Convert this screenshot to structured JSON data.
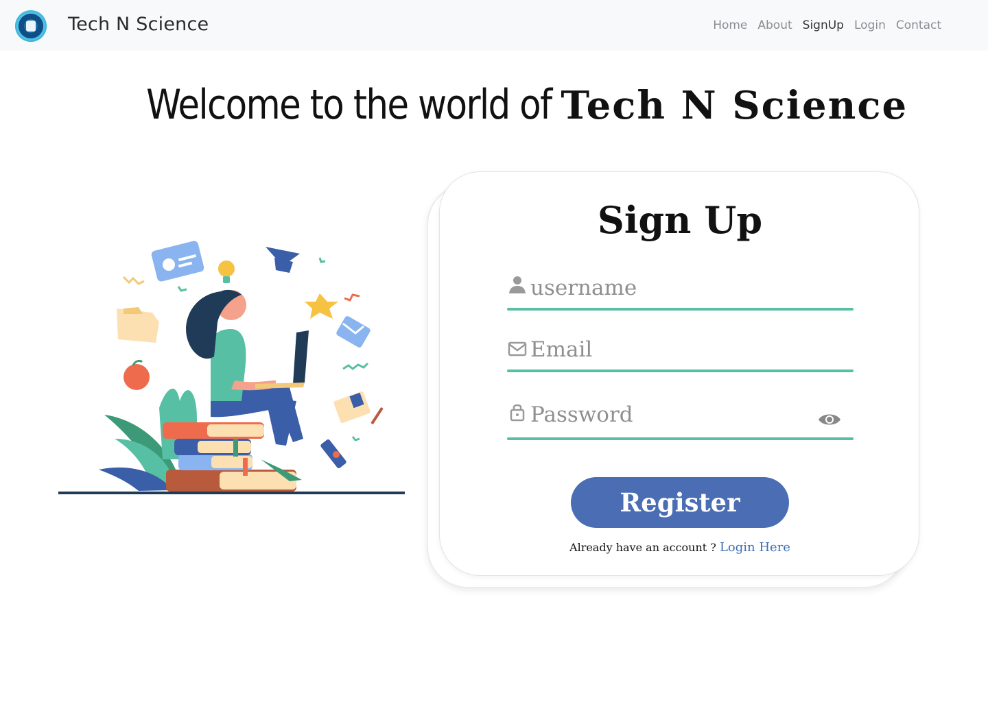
{
  "navbar": {
    "brand": "Tech N Science",
    "links": [
      {
        "label": "Home",
        "active": false
      },
      {
        "label": "About",
        "active": false
      },
      {
        "label": "SignUp",
        "active": true
      },
      {
        "label": "Login",
        "active": false
      },
      {
        "label": "Contact",
        "active": false
      }
    ]
  },
  "headline": {
    "lead": "Welcome to the world of",
    "brand": "Tech N Science"
  },
  "form": {
    "title": "Sign Up",
    "username": {
      "placeholder": "username",
      "value": "",
      "icon": "user-icon"
    },
    "email": {
      "placeholder": "Email",
      "value": "",
      "icon": "mail-icon"
    },
    "password": {
      "placeholder": "Password",
      "value": "",
      "icon": "lock-icon",
      "toggle_icon": "eye-icon"
    },
    "register_label": "Register",
    "already_text": "Already have an account ?",
    "login_link": "Login Here"
  },
  "colors": {
    "accent_line": "#57bfa3",
    "button": "#4a6db4",
    "link": "#3e6fb3"
  }
}
